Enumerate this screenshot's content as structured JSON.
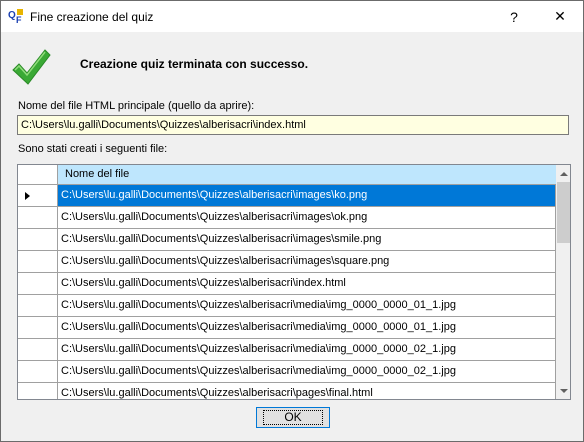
{
  "window": {
    "title": "Fine creazione del quiz",
    "help_label": "?",
    "close_label": "✕",
    "app_icon": "qf-app-icon"
  },
  "message": {
    "icon": "checkmark-icon",
    "text": "Creazione quiz terminata con successo."
  },
  "main_file": {
    "label": "Nome del file HTML principale (quello da aprire):",
    "value": "C:\\Users\\lu.galli\\Documents\\Quizzes\\alberisacri\\index.html"
  },
  "files": {
    "label": "Sono stati creati i seguenti file:",
    "column_header": "Nome del file",
    "rows": [
      "C:\\Users\\lu.galli\\Documents\\Quizzes\\alberisacri\\images\\ko.png",
      "C:\\Users\\lu.galli\\Documents\\Quizzes\\alberisacri\\images\\ok.png",
      "C:\\Users\\lu.galli\\Documents\\Quizzes\\alberisacri\\images\\smile.png",
      "C:\\Users\\lu.galli\\Documents\\Quizzes\\alberisacri\\images\\square.png",
      "C:\\Users\\lu.galli\\Documents\\Quizzes\\alberisacri\\index.html",
      "C:\\Users\\lu.galli\\Documents\\Quizzes\\alberisacri\\media\\img_0000_0000_01_1.jpg",
      "C:\\Users\\lu.galli\\Documents\\Quizzes\\alberisacri\\media\\img_0000_0000_01_1.jpg",
      "C:\\Users\\lu.galli\\Documents\\Quizzes\\alberisacri\\media\\img_0000_0000_02_1.jpg",
      "C:\\Users\\lu.galli\\Documents\\Quizzes\\alberisacri\\media\\img_0000_0000_02_1.jpg",
      "C:\\Users\\lu.galli\\Documents\\Quizzes\\alberisacri\\pages\\final.html"
    ],
    "selected_index": 0
  },
  "ok_label": "OK",
  "colors": {
    "selection": "#0078d7",
    "header": "#bee6fd",
    "check": "#3aa935",
    "field_bg": "#ffffe1"
  }
}
